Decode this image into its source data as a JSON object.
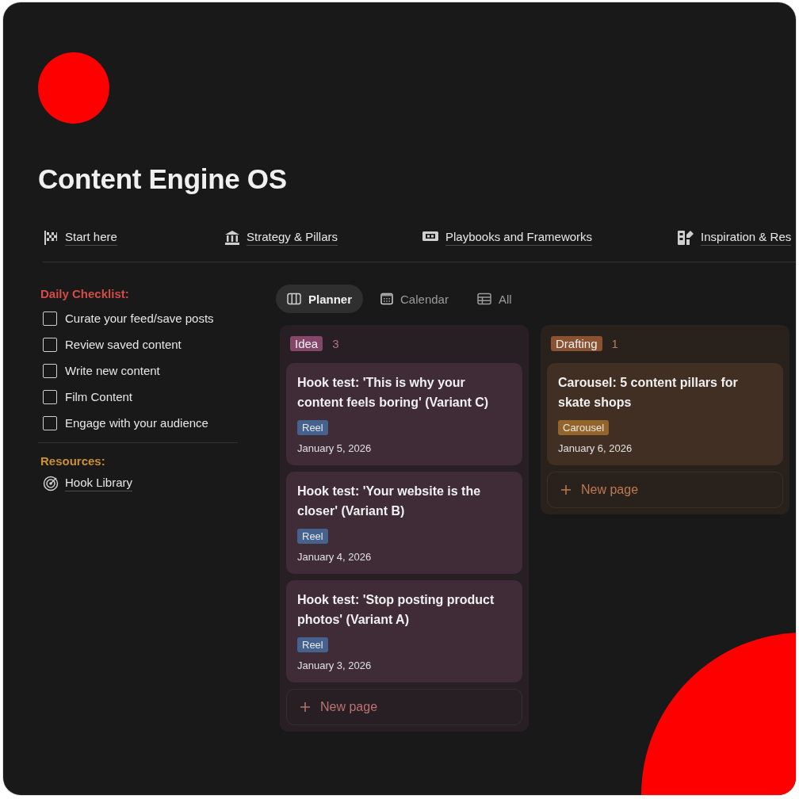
{
  "page": {
    "title": "Content Engine OS"
  },
  "links": [
    {
      "label": "Start here"
    },
    {
      "label": "Strategy & Pillars"
    },
    {
      "label": "Playbooks and Frameworks"
    },
    {
      "label": "Inspiration & Res"
    }
  ],
  "checklist": {
    "heading": "Daily Checklist:",
    "items": [
      {
        "label": "Curate your feed/save posts",
        "checked": false
      },
      {
        "label": "Review saved content",
        "checked": false
      },
      {
        "label": "Write new content",
        "checked": false
      },
      {
        "label": "Film Content",
        "checked": false
      },
      {
        "label": "Engage with your audience",
        "checked": false
      }
    ]
  },
  "resources": {
    "heading": "Resources:",
    "links": [
      {
        "label": "Hook Library"
      }
    ]
  },
  "views": [
    {
      "label": "Planner",
      "selected": true
    },
    {
      "label": "Calendar",
      "selected": false
    },
    {
      "label": "All",
      "selected": false
    }
  ],
  "board": {
    "columns": [
      {
        "name": "Idea",
        "count": "3",
        "color": "#84476a",
        "cards": [
          {
            "title": "Hook test: 'This is why your content feels boring' (Variant C)",
            "tag": {
              "label": "Reel",
              "color": "#45628f"
            },
            "date": "January 5, 2026"
          },
          {
            "title": "Hook test: 'Your website is the closer' (Variant B)",
            "tag": {
              "label": "Reel",
              "color": "#45628f"
            },
            "date": "January 4, 2026"
          },
          {
            "title": "Hook test: 'Stop posting product photos' (Variant A)",
            "tag": {
              "label": "Reel",
              "color": "#45628f"
            },
            "date": "January 3, 2026"
          }
        ],
        "new_page": "New page"
      },
      {
        "name": "Drafting",
        "count": "1",
        "color": "#8a5230",
        "cards": [
          {
            "title": "Carousel: 5 content pillars for skate shops",
            "tag": {
              "label": "Carousel",
              "color": "#93652a"
            },
            "date": "January 6, 2026"
          }
        ],
        "new_page": "New page"
      }
    ]
  }
}
